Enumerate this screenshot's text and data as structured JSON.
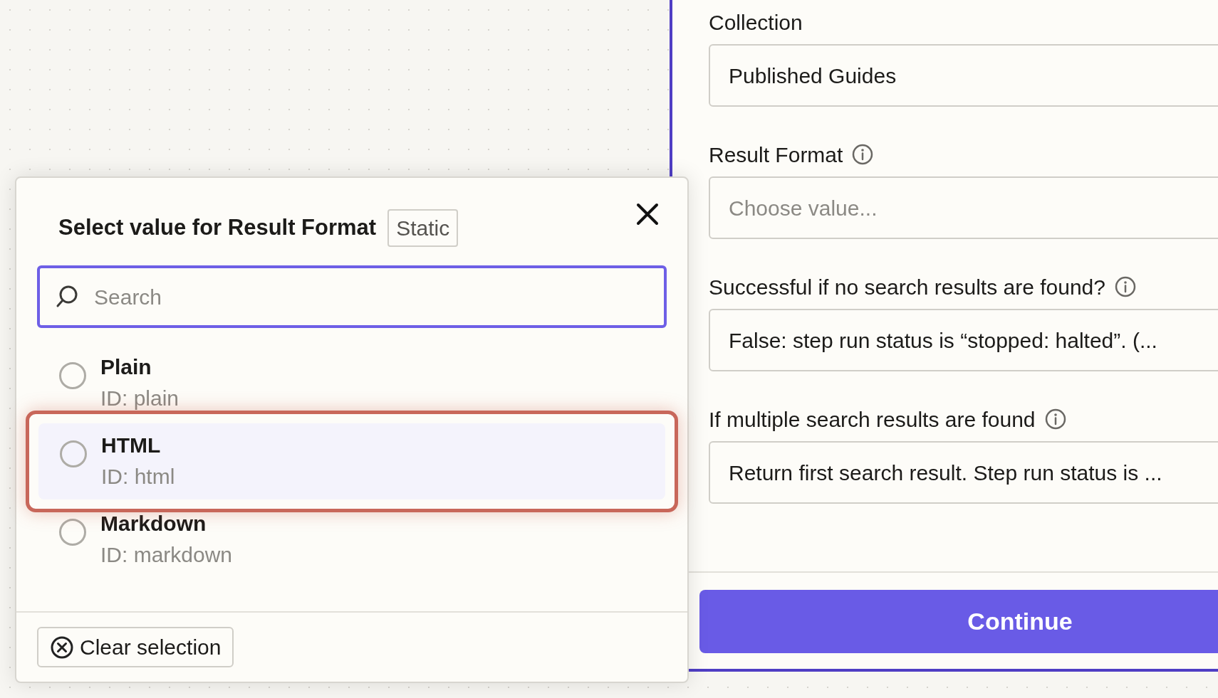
{
  "fields": [
    {
      "label": "Collection",
      "info": false,
      "value": "Published Guides"
    },
    {
      "label": "Result Format",
      "info": true,
      "placeholder": "Choose value..."
    },
    {
      "label": "Successful if no search results are found?",
      "info": true,
      "value": "False: step run status is “stopped: halted”. (..."
    },
    {
      "label": "If multiple search results are found",
      "info": true,
      "value": "Return first search result. Step run status is ..."
    }
  ],
  "continue_button": "Continue",
  "popup": {
    "title": "Select value for Result Format",
    "badge": "Static",
    "search": {
      "placeholder": "Search"
    },
    "options": [
      {
        "label": "Plain",
        "id": "ID: plain",
        "selected": false,
        "highlighted": false
      },
      {
        "label": "HTML",
        "id": "ID: html",
        "selected": false,
        "highlighted": true
      },
      {
        "label": "Markdown",
        "id": "ID: markdown",
        "selected": false,
        "highlighted": false
      }
    ],
    "clear_button": "Clear selection"
  }
}
